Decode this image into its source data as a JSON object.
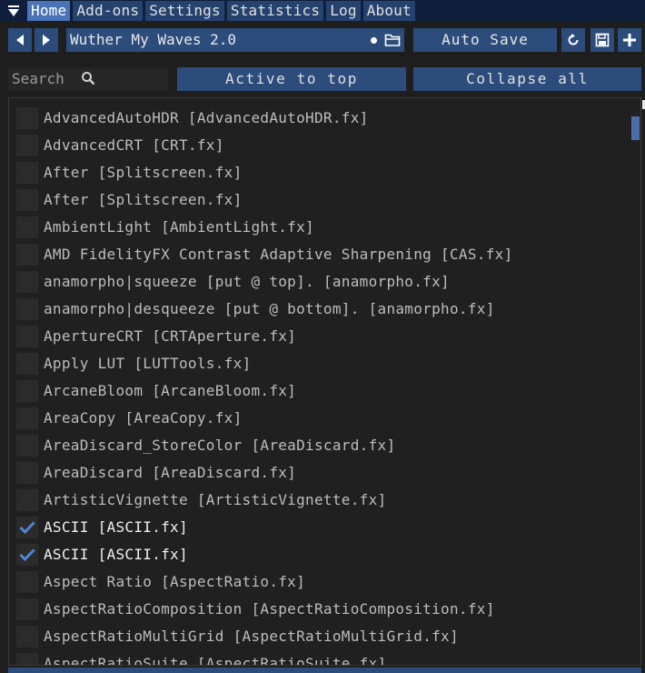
{
  "tabs": [
    {
      "label": "Home",
      "active": true
    },
    {
      "label": "Add-ons",
      "active": false
    },
    {
      "label": "Settings",
      "active": false
    },
    {
      "label": "Statistics",
      "active": false
    },
    {
      "label": "Log",
      "active": false
    },
    {
      "label": "About",
      "active": false
    }
  ],
  "toolbar": {
    "preset_name": "Wuther My Waves 2.0",
    "auto_save_label": "Auto Save"
  },
  "filter": {
    "search_placeholder": "Search",
    "active_to_top_label": "Active to top",
    "collapse_all_label": "Collapse all"
  },
  "effects": [
    {
      "label": "AdvancedAutoHDR [AdvancedAutoHDR.fx]",
      "checked": false
    },
    {
      "label": "AdvancedCRT [CRT.fx]",
      "checked": false
    },
    {
      "label": "After [Splitscreen.fx]",
      "checked": false
    },
    {
      "label": "After [Splitscreen.fx]",
      "checked": false
    },
    {
      "label": "AmbientLight [AmbientLight.fx]",
      "checked": false
    },
    {
      "label": "AMD FidelityFX Contrast Adaptive Sharpening [CAS.fx]",
      "checked": false
    },
    {
      "label": "anamorpho|squeeze [put @ top]. [anamorpho.fx]",
      "checked": false
    },
    {
      "label": "anamorpho|desqueeze [put @ bottom]. [anamorpho.fx]",
      "checked": false
    },
    {
      "label": "ApertureCRT [CRTAperture.fx]",
      "checked": false
    },
    {
      "label": "Apply LUT [LUTTools.fx]",
      "checked": false
    },
    {
      "label": "ArcaneBloom [ArcaneBloom.fx]",
      "checked": false
    },
    {
      "label": "AreaCopy [AreaCopy.fx]",
      "checked": false
    },
    {
      "label": "AreaDiscard_StoreColor [AreaDiscard.fx]",
      "checked": false
    },
    {
      "label": "AreaDiscard [AreaDiscard.fx]",
      "checked": false
    },
    {
      "label": "ArtisticVignette [ArtisticVignette.fx]",
      "checked": false
    },
    {
      "label": "ASCII [ASCII.fx]",
      "checked": true
    },
    {
      "label": "ASCII [ASCII.fx]",
      "checked": true
    },
    {
      "label": "Aspect Ratio [AspectRatio.fx]",
      "checked": false
    },
    {
      "label": "AspectRatioComposition [AspectRatioComposition.fx]",
      "checked": false
    },
    {
      "label": "AspectRatioMultiGrid [AspectRatioMultiGrid.fx]",
      "checked": false
    },
    {
      "label": "AspectRatioSuite [AspectRatioSuite.fx]",
      "checked": false
    }
  ],
  "colors": {
    "accent": "#4a74b6",
    "check": "#4f86d6"
  },
  "icons": {
    "menu": "triangle-down-icon",
    "prev": "arrow-left-icon",
    "next": "arrow-right-icon",
    "folder": "folder-icon",
    "reload": "reload-icon",
    "save": "save-icon",
    "add": "plus-icon",
    "search": "search-icon",
    "check": "checkmark-icon"
  }
}
